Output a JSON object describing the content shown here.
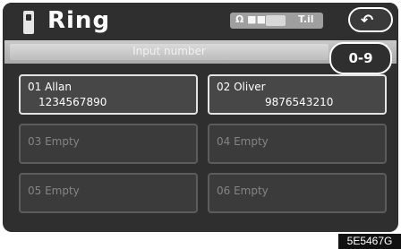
{
  "header": {
    "title": "Ring",
    "status_left": "Ω ■■",
    "status_right": "T.il"
  },
  "input": {
    "placeholder": "Input number",
    "number_button_label": "0-9"
  },
  "entries": [
    {
      "name": "01 Allan",
      "phone": "1234567890"
    },
    {
      "name": "02 Oliver",
      "phone": "9876543210"
    },
    {
      "name": "03 Empty",
      "phone": ""
    },
    {
      "name": "04 Empty",
      "phone": ""
    },
    {
      "name": "05 Empty",
      "phone": ""
    },
    {
      "name": "06 Empty",
      "phone": ""
    }
  ],
  "corner_code": "5E5467G",
  "icons": {
    "phone": "phone-icon",
    "back": "back-arrow-icon"
  },
  "colors": {
    "screen_bg": "#2f2f2f",
    "input_bar": "#c0c0c0",
    "text": "#ffffff"
  }
}
